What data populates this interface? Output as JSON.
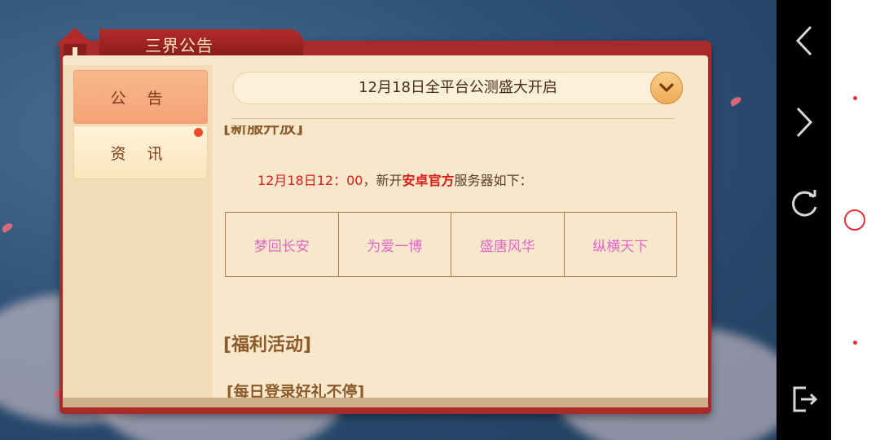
{
  "panel": {
    "title": "三界公告"
  },
  "tabs": [
    {
      "label": "公 告",
      "active": true
    },
    {
      "label": "资 讯",
      "active": false,
      "has_badge": true
    }
  ],
  "announcement": {
    "dropdown_title": "12月18日全平台公测盛大开启",
    "cut_heading": "[新服开放]",
    "notice_prefix": "12月18日12：00",
    "notice_mid": "，新开",
    "notice_highlight": "安卓官方",
    "notice_suffix": "服务器如下：",
    "servers": [
      "梦回长安",
      "为爱一博",
      "盛唐风华",
      "纵横天下"
    ],
    "section_title": "[福利活动]",
    "section_sub": "[每日登录好礼不停]"
  },
  "colors": {
    "accent_red": "#d81b1b",
    "server_pink": "#e066c8",
    "heading_brown": "#8b5a2b"
  },
  "navbar": {
    "back_icon": "chevron-left-icon",
    "forward_icon": "chevron-right-icon",
    "refresh_icon": "refresh-icon",
    "exit_icon": "exit-icon"
  }
}
